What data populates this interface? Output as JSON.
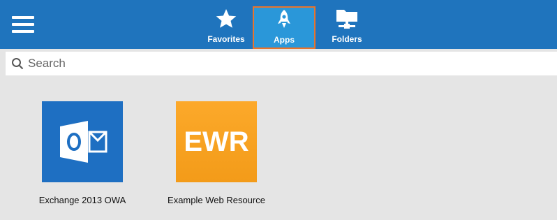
{
  "nav": {
    "tabs": [
      {
        "label": "Favorites",
        "icon": "star-icon"
      },
      {
        "label": "Apps",
        "icon": "rocket-icon",
        "active": true
      },
      {
        "label": "Folders",
        "icon": "folder-network-icon"
      }
    ]
  },
  "search": {
    "placeholder": "Search"
  },
  "apps": [
    {
      "name": "Exchange 2013 OWA",
      "icon": "outlook-icon",
      "color": "#1e6fc2"
    },
    {
      "name": "Example Web Resource",
      "icon_text": "EWR",
      "color": "#f7a11f"
    }
  ],
  "colors": {
    "header": "#1f74bd",
    "active_tab": "#2a97d9",
    "active_border": "#e8742c",
    "content_bg": "#e5e5e5"
  }
}
